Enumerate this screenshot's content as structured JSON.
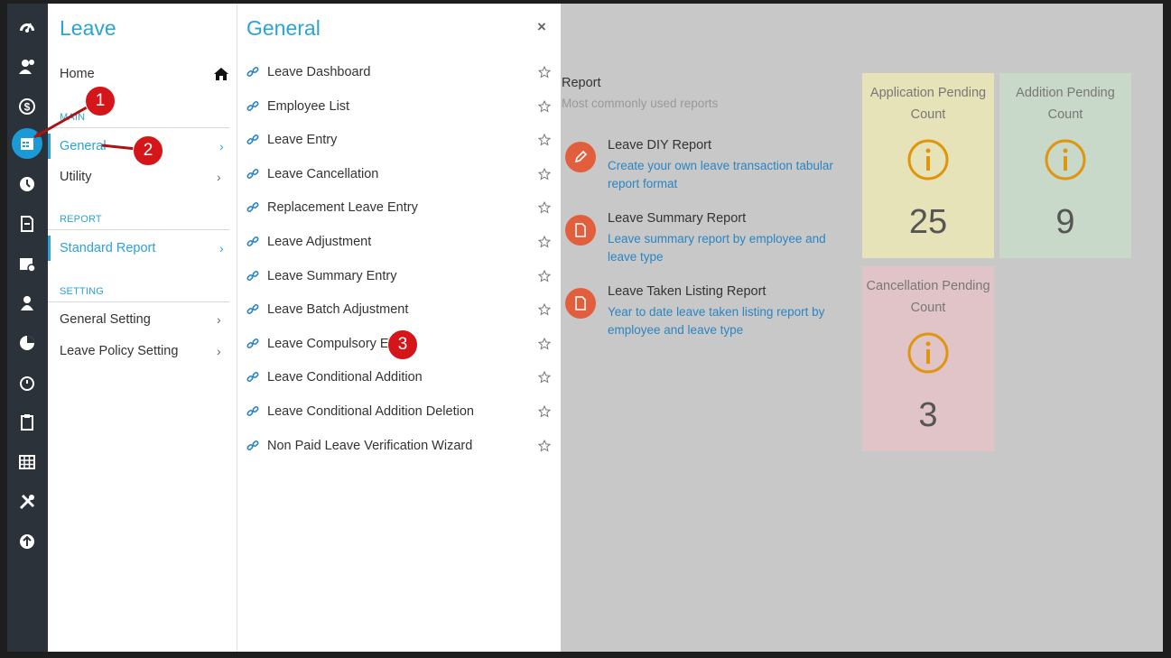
{
  "rail_icons": [
    "dashboard-icon",
    "people-icon",
    "dollar-icon",
    "calendar-icon",
    "clock-icon",
    "document-icon",
    "calendar-event-icon",
    "person-icon",
    "pie-chart-icon",
    "timer-icon",
    "clipboard-icon",
    "table-icon",
    "tools-icon",
    "arrow-up-circle-icon"
  ],
  "menu1": {
    "title": "Leave",
    "home_label": "Home",
    "main_section": "MAIN",
    "general_label": "General",
    "utility_label": "Utility",
    "report_section": "REPORT",
    "standard_report_label": "Standard Report",
    "setting_section": "SETTING",
    "general_setting_label": "General Setting",
    "leave_policy_label": "Leave Policy Setting",
    "chevron": "›"
  },
  "menu2": {
    "title": "General",
    "close_label": "×",
    "items": [
      {
        "label": "Leave Dashboard"
      },
      {
        "label": "Employee List"
      },
      {
        "label": "Leave Entry"
      },
      {
        "label": "Leave Cancellation"
      },
      {
        "label": "Replacement Leave Entry"
      },
      {
        "label": "Leave Adjustment"
      },
      {
        "label": "Leave Summary Entry"
      },
      {
        "label": "Leave Batch Adjustment"
      },
      {
        "label": "Leave Compulsory Entry"
      },
      {
        "label": "Leave Conditional Addition"
      },
      {
        "label": "Leave Conditional Addition Deletion"
      },
      {
        "label": "Non Paid Leave Verification Wizard"
      }
    ]
  },
  "report": {
    "heading": "Report",
    "subheading": "Most commonly used reports",
    "items": [
      {
        "title": "Leave DIY Report",
        "desc": "Create your own leave transaction tabular report format",
        "icon": "pencil-icon"
      },
      {
        "title": "Leave Summary Report",
        "desc": "Leave summary report by employee and leave type",
        "icon": "file-icon"
      },
      {
        "title": "Leave Taken Listing Report",
        "desc": "Year to date leave taken listing report by employee and leave type",
        "icon": "file-icon"
      }
    ]
  },
  "cards": [
    {
      "title": "Application Pending Count",
      "value": "25",
      "bg": "#e6e3b8"
    },
    {
      "title": "Addition Pending Count",
      "value": "9",
      "bg": "#c9d9c9"
    },
    {
      "title": "Cancellation Pending Count",
      "value": "3",
      "bg": "#e0c4c7"
    }
  ],
  "annotations": [
    "1",
    "2",
    "3"
  ],
  "colors": {
    "accent": "#2aa3d6",
    "rail": "#2b323a",
    "report_icon": "#e15f3c",
    "card_icon": "#e0950f",
    "annotation": "#d4161a"
  }
}
